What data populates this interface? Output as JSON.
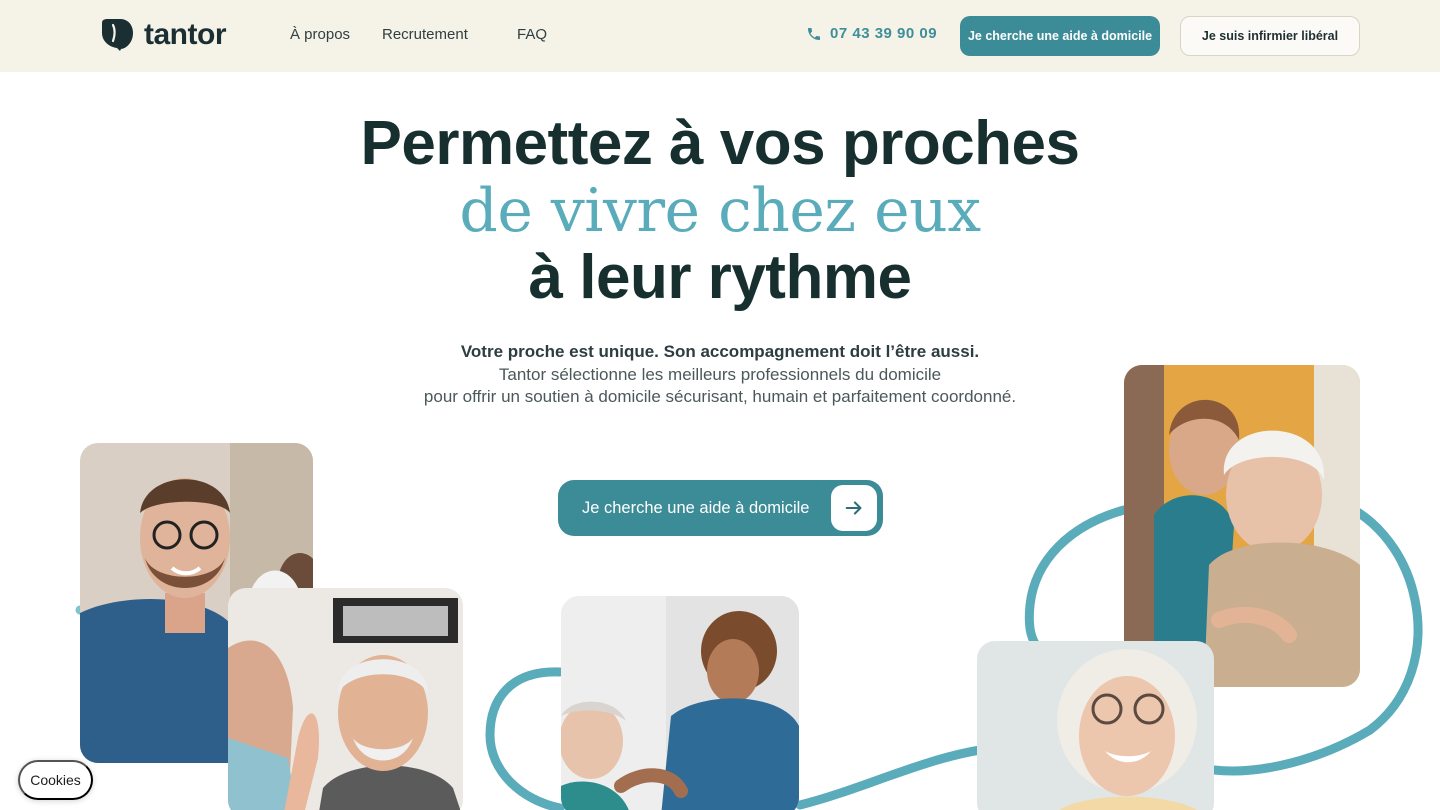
{
  "brand": {
    "name": "tantor",
    "accent": "#3c8c98",
    "light_accent": "#5aacba",
    "header_bg": "#f5f2e8"
  },
  "nav": {
    "items": [
      {
        "label": "À propos"
      },
      {
        "label": "Recrutement"
      },
      {
        "label": "FAQ"
      }
    ],
    "phone": "07 43 39 90 09",
    "primary_button": "Je cherche une aide à domicile",
    "secondary_button": "Je suis infirmier libéral"
  },
  "hero": {
    "line1": "Permettez à vos proches",
    "line2": "de vivre chez eux",
    "line3": "à leur rythme",
    "subtitle_bold": "Votre proche est unique. Son accompagnement doit l’être aussi.",
    "subtitle_line1": "Tantor sélectionne les meilleurs professionnels du domicile",
    "subtitle_line2": "pour offrir un soutien à domicile sécurisant, humain et parfaitement coordonné.",
    "cta_label": "Je cherche une aide à domicile"
  },
  "icons": {
    "phone": "phone-icon",
    "arrow": "arrow-right-icon"
  },
  "cookies": {
    "label": "Cookies"
  }
}
